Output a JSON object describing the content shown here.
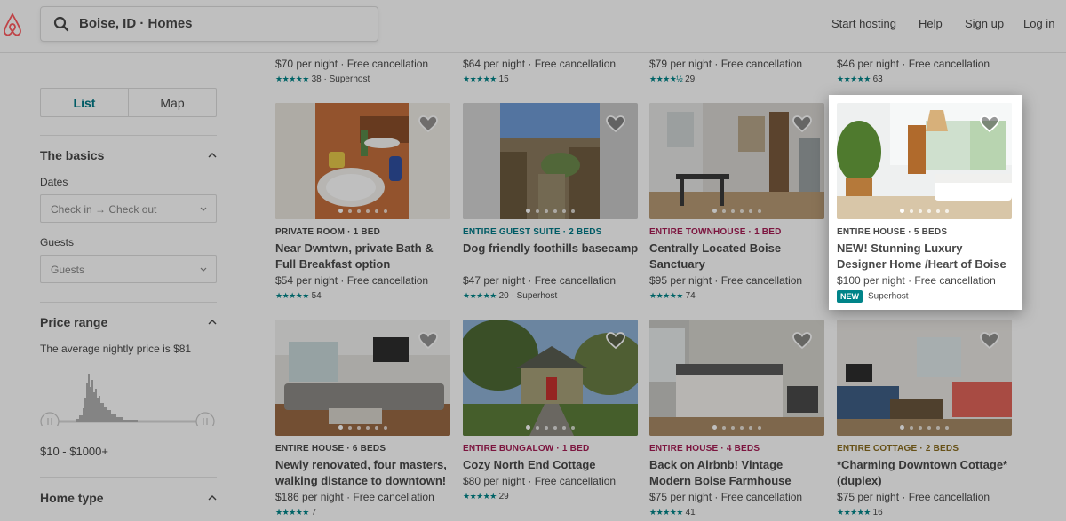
{
  "header": {
    "search_text": "Boise, ID · Homes",
    "nav": [
      "Start hosting",
      "Help",
      "Sign up",
      "Log in"
    ]
  },
  "sidebar": {
    "toggle": {
      "list": "List",
      "map": "Map"
    },
    "basics": {
      "title": "The basics",
      "dates_label": "Dates",
      "dates_placeholder": "Check in → Check out",
      "guests_label": "Guests",
      "guests_placeholder": "Guests"
    },
    "price": {
      "title": "Price range",
      "avg_text": "The average nightly price is $81",
      "range_text": "$10 - $1000+"
    },
    "home_type": {
      "title": "Home type"
    }
  },
  "top_row": [
    {
      "price": "$70 per night · Free cancellation",
      "stars": "★★★★★",
      "rating": "38 · Superhost"
    },
    {
      "price": "$64 per night · Free cancellation",
      "stars": "★★★★★",
      "rating": "15"
    },
    {
      "price": "$79 per night · Free cancellation",
      "stars": "★★★★½",
      "rating": "29"
    },
    {
      "price": "$46 per night · Free cancellation",
      "stars": "★★★★★",
      "rating": "63"
    }
  ],
  "listings": [
    {
      "kind": "PRIVATE ROOM · 1 BED",
      "kind_color": "#484848",
      "name": "Near Dwntwn, private Bath & Full Breakfast option",
      "price": "$54 per night · Free cancellation",
      "stars": "★★★★★",
      "rating": "54"
    },
    {
      "kind": "ENTIRE GUEST SUITE · 2 BEDS",
      "kind_color": "#007a87",
      "name": "Dog friendly foothills basecamp",
      "price": "$47 per night · Free cancellation",
      "stars": "★★★★★",
      "rating": "20 · Superhost"
    },
    {
      "kind": "ENTIRE TOWNHOUSE · 1 BED",
      "kind_color": "#a61d55",
      "name": "Centrally Located Boise Sanctuary",
      "price": "$95 per night · Free cancellation",
      "stars": "★★★★★",
      "rating": "74"
    },
    {
      "kind": "ENTIRE HOUSE · 5 BEDS",
      "kind_color": "#484848",
      "name": "NEW! Stunning Luxury Designer Home /Heart of Boise",
      "price": "$100 per night · Free cancellation",
      "badge": "NEW",
      "rating": "Superhost"
    },
    {
      "kind": "ENTIRE HOUSE · 6 BEDS",
      "kind_color": "#484848",
      "name": "Newly renovated, four masters, walking distance to downtown!",
      "price": "$186 per night · Free cancellation",
      "stars": "★★★★★",
      "rating": "7"
    },
    {
      "kind": "ENTIRE BUNGALOW · 1 BED",
      "kind_color": "#a61d55",
      "name": "Cozy North End Cottage",
      "price": "$80 per night · Free cancellation",
      "stars": "★★★★★",
      "rating": "29"
    },
    {
      "kind": "ENTIRE HOUSE · 4 BEDS",
      "kind_color": "#a61d55",
      "name": "Back on Airbnb! Vintage Modern Boise Farmhouse",
      "price": "$75 per night · Free cancellation",
      "stars": "★★★★★",
      "rating": "41"
    },
    {
      "kind": "ENTIRE COTTAGE · 2 BEDS",
      "kind_color": "#8a6d1f",
      "name": "*Charming Downtown Cottage*(duplex)",
      "price": "$75 per night · Free cancellation",
      "stars": "★★★★★",
      "rating": "16"
    }
  ],
  "colors": {
    "brand": "#ff5a5f",
    "teal": "#008489",
    "text": "#484848"
  },
  "icons": [
    "airbnb-logo",
    "search-icon",
    "chevron-up-icon",
    "chevron-down-icon",
    "heart-icon"
  ]
}
